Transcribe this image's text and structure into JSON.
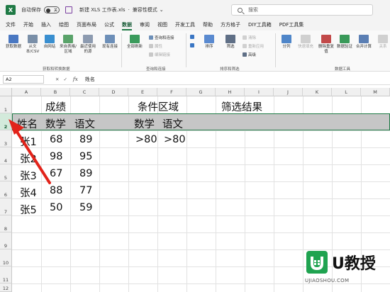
{
  "titlebar": {
    "autosave_label": "自动保存",
    "autosave_state": "关",
    "filename": "新建 XLS 工作表.xls",
    "mode": "兼容性模式",
    "search_placeholder": "搜索"
  },
  "tabs": [
    "文件",
    "开始",
    "插入",
    "绘图",
    "页面布局",
    "公式",
    "数据",
    "审阅",
    "视图",
    "开发工具",
    "帮助",
    "方方格子",
    "DIY工具箱",
    "PDF工具集"
  ],
  "active_tab": "数据",
  "ribbon": {
    "get_data": "获取数据",
    "from_text": "从文本/CSV",
    "from_web": "自网站",
    "from_table": "来自表格/区域",
    "recent_sources": "最近使用的源",
    "existing_conn": "现有连接",
    "group1": "获取和转换数据",
    "refresh_all": "全部刷新",
    "queries_conn": "查询和连接",
    "properties": "属性",
    "edit_links": "编辑链接",
    "group2": "查询和连接",
    "sort": "排序",
    "filter": "筛选",
    "clear": "清除",
    "reapply": "重新应用",
    "advanced": "高级",
    "group3": "排序和筛选",
    "split": "分列",
    "flash_fill": "快速填充",
    "remove_dup": "删除重复值",
    "validation": "数据验证",
    "consolidate": "合并计算",
    "relations": "关系",
    "group4": "数据工具"
  },
  "formula_bar": {
    "name_box": "A2",
    "value": "姓名"
  },
  "columns": [
    "A",
    "B",
    "C",
    "D",
    "E",
    "F",
    "G",
    "H",
    "I",
    "J",
    "K",
    "L",
    "M"
  ],
  "rows": [
    "1",
    "2",
    "3",
    "4",
    "5",
    "6",
    "7",
    "8",
    "9",
    "10",
    "11",
    "12"
  ],
  "sheet": {
    "title_scores": "成绩",
    "title_criteria": "条件区域",
    "title_result": "筛选结果",
    "headers": [
      "姓名",
      "数学",
      "语文"
    ],
    "criteria_headers": [
      "数学",
      "语文"
    ],
    "criteria_values": [
      ">80",
      ">80"
    ],
    "records": [
      [
        "张1",
        "68",
        "89"
      ],
      [
        "张2",
        "98",
        "95"
      ],
      [
        "张3",
        "67",
        "89"
      ],
      [
        "张4",
        "88",
        "77"
      ],
      [
        "张5",
        "50",
        "59"
      ]
    ]
  },
  "watermark": {
    "brand": "U教授",
    "url": "UJIAOSHOU.COM"
  }
}
